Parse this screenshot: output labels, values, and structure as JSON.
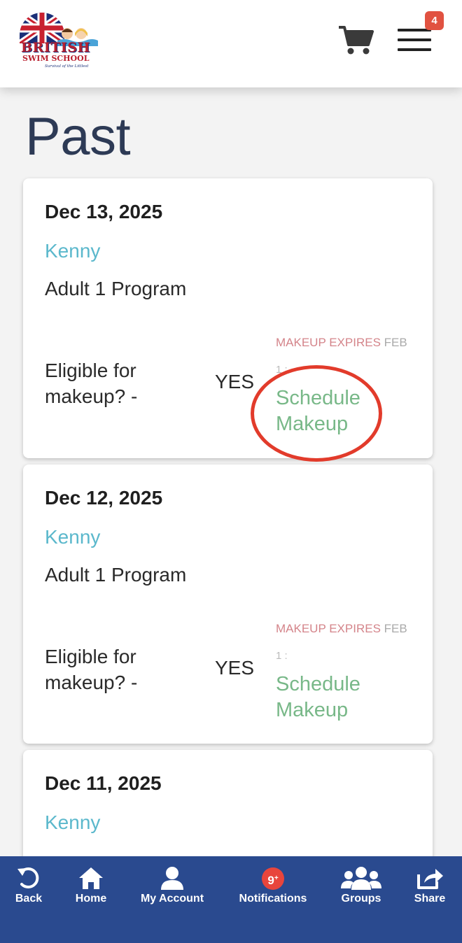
{
  "header": {
    "logo_line1": "BRITISH",
    "logo_line2": "SWIM SCHOOL",
    "logo_tagline": "Survival of the Littlest",
    "cart_icon": "cart-icon",
    "menu_icon": "hamburger-menu-icon",
    "menu_badge": "4"
  },
  "page": {
    "title": "Past"
  },
  "lessons": [
    {
      "date": "Dec 13, 2025",
      "student": "Kenny",
      "program": "Adult 1 Program",
      "eligible_label": "Eligible for makeup? -",
      "eligible_value": "YES",
      "expires_label": "MAKEUP EXPIRES",
      "expires_month": "FEB",
      "expires_day": "1 :",
      "action": "Schedule Makeup"
    },
    {
      "date": "Dec 12, 2025",
      "student": "Kenny",
      "program": "Adult 1 Program",
      "eligible_label": "Eligible for makeup? -",
      "eligible_value": "YES",
      "expires_label": "MAKEUP EXPIRES",
      "expires_month": "FEB",
      "expires_day": "1 :",
      "action": "Schedule Makeup"
    },
    {
      "date": "Dec 11, 2025",
      "student": "Kenny"
    }
  ],
  "bottom_nav": {
    "back": "Back",
    "home": "Home",
    "account": "My Account",
    "notifications": "Notifications",
    "notifications_badge": "9",
    "notifications_badge_plus": "+",
    "groups": "Groups",
    "share": "Share"
  },
  "colors": {
    "nav_background": "#2a4a8f",
    "student_name": "#5bb8cc",
    "schedule_link": "#78b888",
    "expires_label": "#d4848a",
    "badge": "#e15241",
    "highlight": "#e23b2b"
  }
}
